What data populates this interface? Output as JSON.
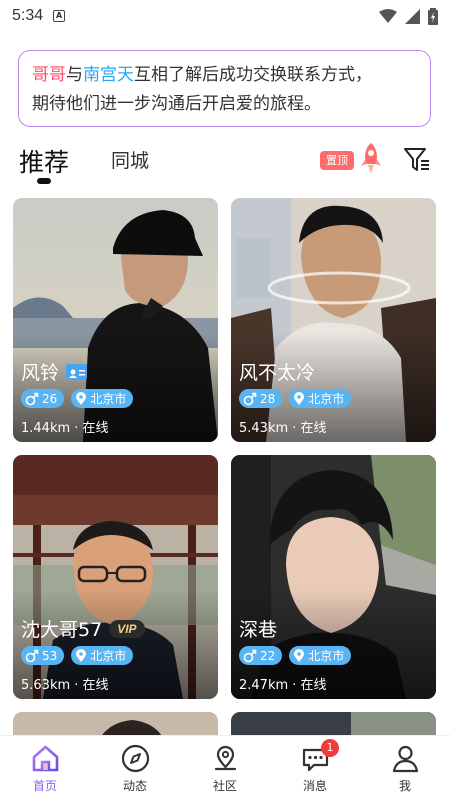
{
  "status_bar": {
    "time": "5:34",
    "app_icon_letter": "A"
  },
  "notice": {
    "name1": "哥哥",
    "connector": "与",
    "name2": "南宫天",
    "text1": "互相了解后成功交换联系方式，",
    "text2": "期待他们进一步沟通后开启爱的旅程。"
  },
  "tabs": {
    "recommend": "推荐",
    "same_city": "同城",
    "pin_top": "置顶"
  },
  "cards": [
    {
      "name": "风铃",
      "age": "26",
      "city": "北京市",
      "distance": "1.44km · 在线",
      "verified": true
    },
    {
      "name": "风不太冷",
      "age": "28",
      "city": "北京市",
      "distance": "5.43km · 在线"
    },
    {
      "name": "沈大哥57",
      "age": "53",
      "city": "北京市",
      "distance": "5.63km · 在线",
      "vip": "VIP"
    },
    {
      "name": "深巷",
      "age": "22",
      "city": "北京市",
      "distance": "2.47km · 在线"
    }
  ],
  "bottom_nav": [
    {
      "label": "首页",
      "icon": "home-icon",
      "active": true
    },
    {
      "label": "动态",
      "icon": "compass-icon"
    },
    {
      "label": "社区",
      "icon": "location-pin-icon"
    },
    {
      "label": "消息",
      "icon": "chat-icon",
      "badge": "1"
    },
    {
      "label": "我",
      "icon": "user-icon"
    }
  ],
  "colors": {
    "accent": "#8b63e8",
    "tag_blue": "#58b4f2",
    "pin_red": "#ff6b6b",
    "notice_border": "#b68ae8"
  }
}
